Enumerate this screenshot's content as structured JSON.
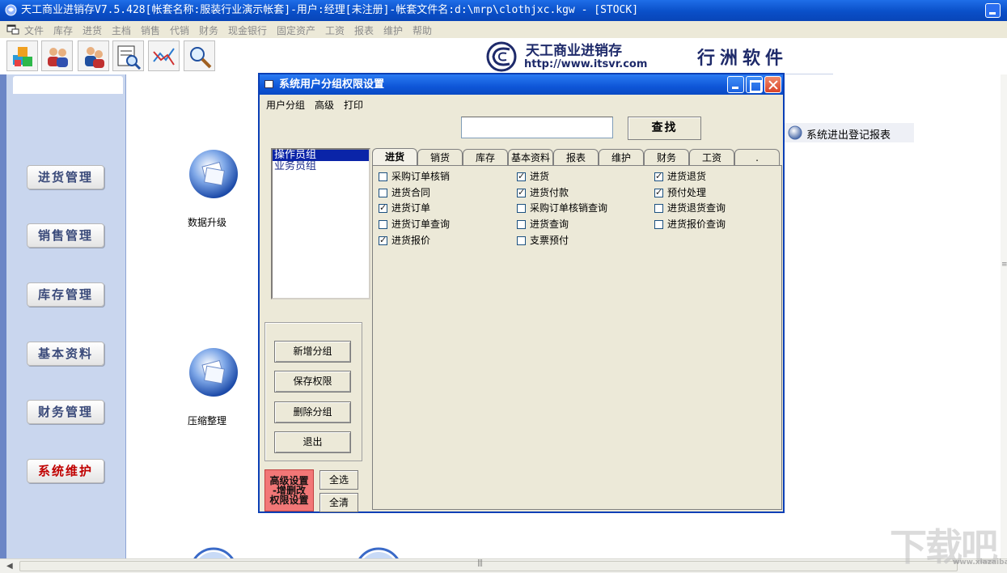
{
  "app": {
    "title": "天工商业进销存V7.5.428[帐套名称:服装行业演示帐套]-用户:经理[未注册]-帐套文件名:d:\\mrp\\clothjxc.kgw - [STOCK]"
  },
  "menu": [
    "文件",
    "库存",
    "进货",
    "主档",
    "销售",
    "代销",
    "财务",
    "现金银行",
    "固定资产",
    "工资",
    "报表",
    "维护",
    "帮助"
  ],
  "toolbar": {
    "buttons": [
      "cubes-icon",
      "users-icon",
      "user-group-icon",
      "report-search-icon",
      "chart-icon",
      "magnifier-icon"
    ]
  },
  "logo": {
    "name": "天工商业进销存",
    "url": "http://www.itsvr.com",
    "company": "行洲软件"
  },
  "sidebar": {
    "items": [
      {
        "label": "进货管理",
        "active": false
      },
      {
        "label": "销售管理",
        "active": false
      },
      {
        "label": "库存管理",
        "active": false
      },
      {
        "label": "基本资料",
        "active": false
      },
      {
        "label": "财务管理",
        "active": false
      },
      {
        "label": "系统维护",
        "active": true
      }
    ]
  },
  "desktop": {
    "icons": [
      {
        "label": "数据升级"
      },
      {
        "label": "压缩整理"
      }
    ],
    "report_link": "系统进出登记报表"
  },
  "dialog": {
    "title": "系统用户分组权限设置",
    "menu": [
      "用户分组",
      "高级",
      "打印"
    ],
    "search_value": "",
    "find_label": "查找",
    "groups": [
      {
        "name": "操作员组",
        "selected": true
      },
      {
        "name": "业务员组",
        "selected": false
      }
    ],
    "buttons": {
      "add": "新增分组",
      "save": "保存权限",
      "delete": "删除分组",
      "exit": "退出"
    },
    "advanced": {
      "line1": "高级设置",
      "line2": "-增删改",
      "line3": "权限设置"
    },
    "select_all": "全选",
    "clear_all": "全清",
    "tabs": [
      "进货",
      "销货",
      "库存",
      "基本资料",
      "报表",
      "维护",
      "财务",
      "工资",
      "."
    ],
    "active_tab": "进货",
    "permissions": [
      [
        {
          "label": "采购订单核销",
          "checked": false
        },
        {
          "label": "进货合同",
          "checked": false
        },
        {
          "label": "进货订单",
          "checked": true
        },
        {
          "label": "进货订单查询",
          "checked": false
        },
        {
          "label": "进货报价",
          "checked": true
        }
      ],
      [
        {
          "label": "进货",
          "checked": true
        },
        {
          "label": "进货付款",
          "checked": true
        },
        {
          "label": "采购订单核销查询",
          "checked": false
        },
        {
          "label": "进货查询",
          "checked": false
        },
        {
          "label": "支票预付",
          "checked": false
        }
      ],
      [
        {
          "label": "进货退货",
          "checked": true
        },
        {
          "label": "预付处理",
          "checked": true
        },
        {
          "label": "进货退货查询",
          "checked": false
        },
        {
          "label": "进货报价查询",
          "checked": false
        }
      ]
    ]
  },
  "watermark": {
    "text": "下载吧",
    "sub": "www.xiazaiba.com"
  },
  "colors": {
    "titlebar": "#0a4fc8",
    "sidebar_bg": "#c9d6ee",
    "active_nav": "#c00000",
    "advanced_btn": "#f27777",
    "dialog_bg": "#ece9d8"
  }
}
